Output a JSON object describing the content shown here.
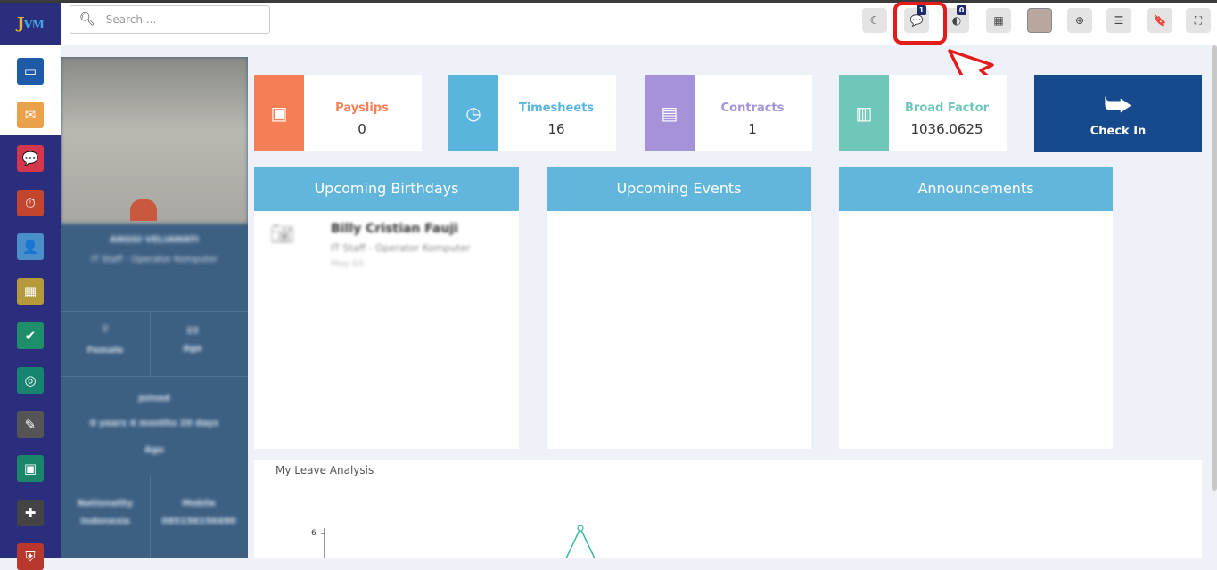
{
  "app": {
    "logo_text": "JVM"
  },
  "topbar": {
    "search_placeholder": "Search ...",
    "buttons": [
      {
        "name": "theme-toggle",
        "icon": "moon-icon",
        "glyph": "☾"
      },
      {
        "name": "chat",
        "icon": "chat-icon",
        "glyph": "💬",
        "badge": "1"
      },
      {
        "name": "notifications",
        "icon": "eye-icon",
        "glyph": "◐",
        "badge": "0"
      },
      {
        "name": "calculator",
        "icon": "calculator-icon",
        "glyph": "▦"
      },
      {
        "name": "user-avatar",
        "icon": "avatar-icon",
        "glyph": ""
      },
      {
        "name": "language",
        "icon": "globe-icon",
        "glyph": "⊕"
      },
      {
        "name": "menu",
        "icon": "menu-icon",
        "glyph": "☰"
      },
      {
        "name": "bookmark",
        "icon": "bookmark-icon",
        "glyph": "🔖"
      },
      {
        "name": "fullscreen",
        "icon": "fullscreen-icon",
        "glyph": "⛶"
      }
    ]
  },
  "sidebar": {
    "items": [
      {
        "name": "dashboard",
        "icon": "monitor-icon",
        "color": "#1d5aa8"
      },
      {
        "name": "mail",
        "icon": "mail-icon",
        "color": "#e9a14b"
      },
      {
        "name": "messages",
        "icon": "chat-bubble-icon",
        "color": "#d4364b"
      },
      {
        "name": "timer",
        "icon": "stopwatch-icon",
        "color": "#c2452e"
      },
      {
        "name": "users",
        "icon": "user-clock-icon",
        "color": "#4a8fc9"
      },
      {
        "name": "calendar",
        "icon": "calendar-icon",
        "color": "#b49a3a"
      },
      {
        "name": "monitor-check",
        "icon": "screen-check-icon",
        "color": "#1f8f6b"
      },
      {
        "name": "dashboard-gauge",
        "icon": "gauge-icon",
        "color": "#17846f"
      },
      {
        "name": "notes",
        "icon": "edit-icon",
        "color": "#555555"
      },
      {
        "name": "contacts",
        "icon": "contact-card-icon",
        "color": "#19866a"
      },
      {
        "name": "plugins",
        "icon": "puzzle-icon",
        "color": "#444444"
      },
      {
        "name": "more",
        "icon": "shield-icon",
        "color": "#b8382e"
      }
    ]
  },
  "profile": {
    "name": "ANGGI VELIAWATI",
    "role": "IT Staff - Operator Komputer",
    "gender_label": "Female",
    "age_value": "22",
    "age_label": "Age",
    "joined_label": "Joined",
    "tenure": "0 years 4 months 20 days",
    "tenure_label": "Ago",
    "nationality_label": "Nationality",
    "nationality_value": "Indonesia",
    "mobile_label": "Mobile",
    "mobile_value": "085156156490"
  },
  "stats": [
    {
      "name": "payslips",
      "title": "Payslips",
      "value": "0",
      "icon": "money-icon",
      "glyph": "▣",
      "color": "#f47f57"
    },
    {
      "name": "timesheets",
      "title": "Timesheets",
      "value": "16",
      "icon": "clock-icon",
      "glyph": "◷",
      "color": "#5ab5dc"
    },
    {
      "name": "contracts",
      "title": "Contracts",
      "value": "1",
      "icon": "book-icon",
      "glyph": "▤",
      "color": "#a592d8"
    },
    {
      "name": "broad-factor",
      "title": "Broad Factor",
      "value": "1036.0625",
      "icon": "bar-chart-icon",
      "glyph": "▥",
      "color": "#6fc6b9"
    }
  ],
  "checkin": {
    "label": "Check In",
    "icon": "sign-in-icon"
  },
  "panels": {
    "birthdays": {
      "title": "Upcoming Birthdays",
      "person_name": "Billy Cristian Fauji",
      "person_role": "IT Staff - Operator Komputer",
      "person_date": "May 03"
    },
    "events": {
      "title": "Upcoming Events"
    },
    "announcements": {
      "title": "Announcements"
    }
  },
  "leave": {
    "title": "My Leave Analysis",
    "y_tick": "6"
  },
  "colors": {
    "sidebar": "#2b2e7c",
    "panel_header": "#62b6dc",
    "checkin": "#174a8c",
    "highlight": "#e21b1b"
  }
}
